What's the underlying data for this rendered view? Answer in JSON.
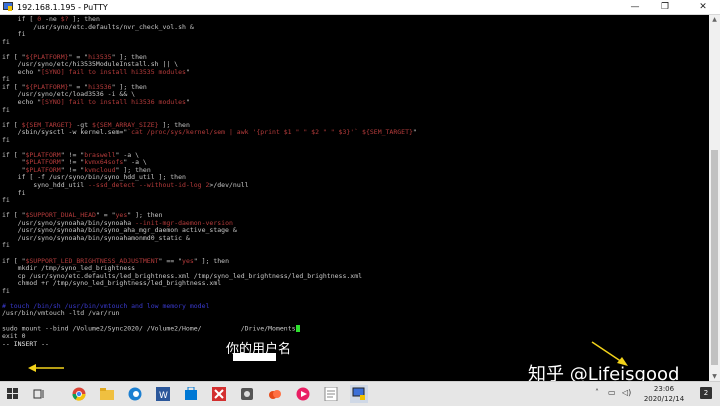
{
  "window": {
    "title": "192.168.1.195 - PuTTY",
    "controls": {
      "minimize": "—",
      "maximize": "❐",
      "close": "✕"
    }
  },
  "terminal": {
    "lines": [
      [
        {
          "t": "    if [ ",
          "c": ""
        },
        {
          "t": "0",
          "c": "red"
        },
        {
          "t": " -ne ",
          "c": ""
        },
        {
          "t": "$?",
          "c": "red"
        },
        {
          "t": " ]; then",
          "c": ""
        }
      ],
      [
        {
          "t": "        /usr/syno/etc.defaults/nvr_check_vol.sh &",
          "c": ""
        }
      ],
      [
        {
          "t": "    fi",
          "c": ""
        }
      ],
      [
        {
          "t": "fi",
          "c": ""
        }
      ],
      [
        {
          "t": "",
          "c": ""
        }
      ],
      [
        {
          "t": "if [ \"",
          "c": ""
        },
        {
          "t": "${PLATFORM}",
          "c": "red"
        },
        {
          "t": "\" = \"",
          "c": ""
        },
        {
          "t": "hi3535",
          "c": "red"
        },
        {
          "t": "\" ]; then",
          "c": ""
        }
      ],
      [
        {
          "t": "    /usr/syno/etc/hi3535ModuleInstall.sh || \\",
          "c": ""
        }
      ],
      [
        {
          "t": "    echo \"",
          "c": ""
        },
        {
          "t": "[SYNO] fail to install hi3535 modules",
          "c": "red"
        },
        {
          "t": "\"",
          "c": ""
        }
      ],
      [
        {
          "t": "fi",
          "c": ""
        }
      ],
      [
        {
          "t": "if [ \"",
          "c": ""
        },
        {
          "t": "${PLATFORM}",
          "c": "red"
        },
        {
          "t": "\" = \"",
          "c": ""
        },
        {
          "t": "hi3536",
          "c": "red"
        },
        {
          "t": "\" ]; then",
          "c": ""
        }
      ],
      [
        {
          "t": "    /usr/syno/etc/load3536 -i && \\",
          "c": ""
        }
      ],
      [
        {
          "t": "    echo \"",
          "c": ""
        },
        {
          "t": "[SYNO] fail to install hi3536 modules",
          "c": "red"
        },
        {
          "t": "\"",
          "c": ""
        }
      ],
      [
        {
          "t": "fi",
          "c": ""
        }
      ],
      [
        {
          "t": "",
          "c": ""
        }
      ],
      [
        {
          "t": "if [ ",
          "c": ""
        },
        {
          "t": "${SEM_TARGET}",
          "c": "red"
        },
        {
          "t": " -gt ",
          "c": ""
        },
        {
          "t": "${SEM_ARRAY_SIZE}",
          "c": "red"
        },
        {
          "t": " ]; then",
          "c": ""
        }
      ],
      [
        {
          "t": "    /sbin/sysctl -w kernel.sem=\"",
          "c": ""
        },
        {
          "t": "`cat /proc/sys/kernel/sem | awk '{print $1 \" \" $2 \" \" $3}'` ${SEM_TARGET}",
          "c": "red"
        },
        {
          "t": "\"",
          "c": ""
        }
      ],
      [
        {
          "t": "fi",
          "c": ""
        }
      ],
      [
        {
          "t": "",
          "c": ""
        }
      ],
      [
        {
          "t": "if [ \"",
          "c": ""
        },
        {
          "t": "$PLATFORM",
          "c": "red"
        },
        {
          "t": "\" != \"",
          "c": ""
        },
        {
          "t": "braswell",
          "c": "red"
        },
        {
          "t": "\" -a \\",
          "c": ""
        }
      ],
      [
        {
          "t": "     \"",
          "c": ""
        },
        {
          "t": "$PLATFORM",
          "c": "red"
        },
        {
          "t": "\" != \"",
          "c": ""
        },
        {
          "t": "kvmx64sofs",
          "c": "red"
        },
        {
          "t": "\" -a \\",
          "c": ""
        }
      ],
      [
        {
          "t": "     \"",
          "c": ""
        },
        {
          "t": "$PLATFORM",
          "c": "red"
        },
        {
          "t": "\" != \"",
          "c": ""
        },
        {
          "t": "kvmcloud",
          "c": "red"
        },
        {
          "t": "\" ]; then",
          "c": ""
        }
      ],
      [
        {
          "t": "    if [ -f /usr/syno/bin/syno_hdd_util ]; then",
          "c": ""
        }
      ],
      [
        {
          "t": "        syno_hdd_util ",
          "c": ""
        },
        {
          "t": "--ssd_detect --without-id-log 2",
          "c": "red"
        },
        {
          "t": ">/dev/null",
          "c": ""
        }
      ],
      [
        {
          "t": "    fi",
          "c": ""
        }
      ],
      [
        {
          "t": "fi",
          "c": ""
        }
      ],
      [
        {
          "t": "",
          "c": ""
        }
      ],
      [
        {
          "t": "if [ \"",
          "c": ""
        },
        {
          "t": "$SUPPORT_DUAL_HEAD",
          "c": "red"
        },
        {
          "t": "\" = \"",
          "c": ""
        },
        {
          "t": "yes",
          "c": "red"
        },
        {
          "t": "\" ]; then",
          "c": ""
        }
      ],
      [
        {
          "t": "    /usr/syno/synoaha/bin/synoaha ",
          "c": ""
        },
        {
          "t": "--init-mgr-daemon-version",
          "c": "red"
        }
      ],
      [
        {
          "t": "    /usr/syno/synoaha/bin/syno_aha_mgr_daemon active_stage &",
          "c": ""
        }
      ],
      [
        {
          "t": "    /usr/syno/synoaha/bin/synoahamonmd0_static &",
          "c": ""
        }
      ],
      [
        {
          "t": "fi",
          "c": ""
        }
      ],
      [
        {
          "t": "",
          "c": ""
        }
      ],
      [
        {
          "t": "if [ \"",
          "c": ""
        },
        {
          "t": "$SUPPORT_LED_BRIGHTNESS_ADJUSTMENT",
          "c": "red"
        },
        {
          "t": "\" == \"",
          "c": ""
        },
        {
          "t": "yes",
          "c": "red"
        },
        {
          "t": "\" ]; then",
          "c": ""
        }
      ],
      [
        {
          "t": "    mkdir /tmp/syno_led_brightness",
          "c": ""
        }
      ],
      [
        {
          "t": "    cp /usr/syno/etc.defaults/led_brightness.xml /tmp/syno_led_brightness/led_brightness.xml",
          "c": ""
        }
      ],
      [
        {
          "t": "    chmod +r /tmp/syno_led_brightness/led_brightness.xml",
          "c": ""
        }
      ],
      [
        {
          "t": "fi",
          "c": ""
        }
      ],
      [
        {
          "t": "",
          "c": ""
        }
      ],
      [
        {
          "t": "# touch /bin/sh /usr/bin/vmtouch and low memory model",
          "c": "blue"
        }
      ],
      [
        {
          "t": "/usr/bin/vmtouch -ltd /var/run",
          "c": ""
        }
      ],
      [
        {
          "t": "",
          "c": ""
        }
      ],
      [
        {
          "t": "sudo mount --bind /Volume2/Sync2020/ /Volume2/Home/",
          "c": ""
        },
        {
          "t": "          ",
          "c": ""
        },
        {
          "t": "/Drive/Moments",
          "c": ""
        },
        {
          "t": "CURSOR",
          "c": "cursor"
        }
      ],
      [
        {
          "t": "exit 0",
          "c": ""
        }
      ],
      [
        {
          "t": "-- INSERT --",
          "c": "white"
        }
      ]
    ]
  },
  "annotations": {
    "username_note": "你的用户名",
    "watermark": "知乎 @Lifeisgood"
  },
  "taskbar": {
    "icons": [
      "windows-start-icon",
      "search-icon",
      "task-view-icon",
      "chrome-icon",
      "explorer-icon",
      "edge-icon",
      "word-icon",
      "store-icon",
      "wps-icon",
      "tool-icon",
      "cloud-icon",
      "media-icon",
      "notes-icon",
      "putty-icon"
    ],
    "clock_time": "23:06",
    "clock_date": "2020/12/14",
    "notifications": "2"
  },
  "colors": {
    "terminal_bg": "#000000",
    "text": "#c8c8c8",
    "keyword": "#b53b3b",
    "comment": "#3a3ad0",
    "cursor": "#2ee02e"
  }
}
